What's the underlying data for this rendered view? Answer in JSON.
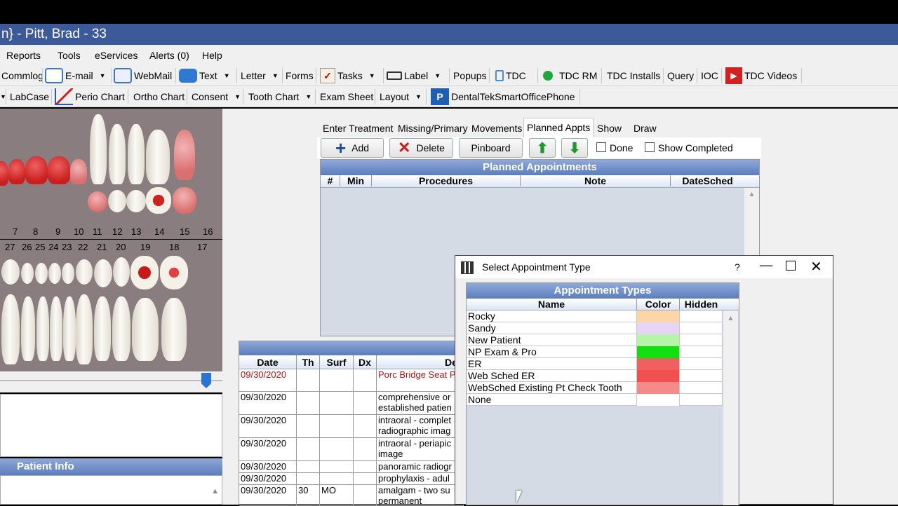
{
  "window": {
    "title": "n} - Pitt, Brad - 33"
  },
  "menu": [
    "Reports",
    "Tools",
    "eServices",
    "Alerts (0)",
    "Help"
  ],
  "toolbar1": [
    {
      "label": "Commlog"
    },
    {
      "label": "E-mail",
      "dropdown": true
    },
    {
      "label": "WebMail"
    },
    {
      "label": "Text",
      "dropdown": true
    },
    {
      "label": "Letter",
      "dropdown": true
    },
    {
      "label": "Forms"
    },
    {
      "label": "Tasks",
      "dropdown": true
    },
    {
      "label": "Label",
      "dropdown": true
    },
    {
      "label": "Popups"
    },
    {
      "label": "TDC"
    },
    {
      "label": "TDC RM"
    },
    {
      "label": "TDC Installs"
    },
    {
      "label": "Query"
    },
    {
      "label": "IOC"
    },
    {
      "label": "TDC Videos"
    }
  ],
  "toolbar2": [
    {
      "label": "LabCase"
    },
    {
      "label": "Perio Chart"
    },
    {
      "label": "Ortho Chart"
    },
    {
      "label": "Consent",
      "dropdown": true
    },
    {
      "label": "Tooth Chart",
      "dropdown": true
    },
    {
      "label": "Exam Sheet"
    },
    {
      "label": "Layout",
      "dropdown": true
    },
    {
      "label": "DentalTekSmartOfficePhone"
    }
  ],
  "tooth_numbers_upper": [
    "7",
    "8",
    "9",
    "10",
    "11",
    "12",
    "13",
    "14",
    "15",
    "16"
  ],
  "tooth_numbers_lower": [
    "27",
    "26",
    "25",
    "24",
    "23",
    "22",
    "21",
    "20",
    "19",
    "18",
    "17"
  ],
  "patient_info": {
    "title": "Patient Info"
  },
  "tabs": [
    "Enter Treatment",
    "Missing/Primary",
    "Movements",
    "Planned Appts",
    "Show",
    "Draw"
  ],
  "active_tab": "Planned Appts",
  "planned_buttons": {
    "add": "Add",
    "delete": "Delete",
    "pinboard": "Pinboard",
    "done": "Done",
    "show_completed": "Show Completed"
  },
  "planned_grid": {
    "title": "Planned Appointments",
    "columns": [
      "#",
      "Min",
      "Procedures",
      "Note",
      "DateSched"
    ]
  },
  "proc_grid": {
    "columns": [
      "Date",
      "Th",
      "Surf",
      "Dx",
      "De"
    ],
    "rows": [
      {
        "date": "09/30/2020",
        "th": "",
        "surf": "",
        "dx": "",
        "desc": "Porc Bridge Seat P",
        "red": true
      },
      {
        "date": "09/30/2020",
        "th": "",
        "surf": "",
        "dx": "",
        "desc": "comprehensive or\nestablished patien"
      },
      {
        "date": "09/30/2020",
        "th": "",
        "surf": "",
        "dx": "",
        "desc": "intraoral - complet\nradiographic imag"
      },
      {
        "date": "09/30/2020",
        "th": "",
        "surf": "",
        "dx": "",
        "desc": "intraoral - periapic\nimage"
      },
      {
        "date": "09/30/2020",
        "th": "",
        "surf": "",
        "dx": "",
        "desc": "panoramic radiogr"
      },
      {
        "date": "09/30/2020",
        "th": "",
        "surf": "",
        "dx": "",
        "desc": "prophylaxis - adul"
      },
      {
        "date": "09/30/2020",
        "th": "30",
        "surf": "MO",
        "dx": "",
        "desc": "amalgam - two su\npermanent"
      }
    ]
  },
  "dialog": {
    "title": "Select Appointment Type",
    "help": "?",
    "grid_title": "Appointment Types",
    "columns": [
      "Name",
      "Color",
      "Hidden"
    ],
    "rows": [
      {
        "name": "Rocky",
        "color": "#fcd5a8",
        "hidden": ""
      },
      {
        "name": "Sandy",
        "color": "#e8d4f5",
        "hidden": ""
      },
      {
        "name": "New Patient",
        "color": "#b4f5a8",
        "hidden": ""
      },
      {
        "name": "NP Exam & Pro",
        "color": "#10e010",
        "hidden": ""
      },
      {
        "name": "ER",
        "color": "#f06060",
        "hidden": ""
      },
      {
        "name": "Web Sched ER",
        "color": "#f25050",
        "hidden": ""
      },
      {
        "name": "WebSched Existing Pt Check Tooth",
        "color": "#f58a8a",
        "hidden": ""
      },
      {
        "name": "None",
        "color": "#ffffff",
        "hidden": ""
      }
    ]
  },
  "colors": {
    "titlebar": "#3c5a9a",
    "grid_header": "#5c7dbd",
    "grid_body": "#d4dbe5"
  }
}
